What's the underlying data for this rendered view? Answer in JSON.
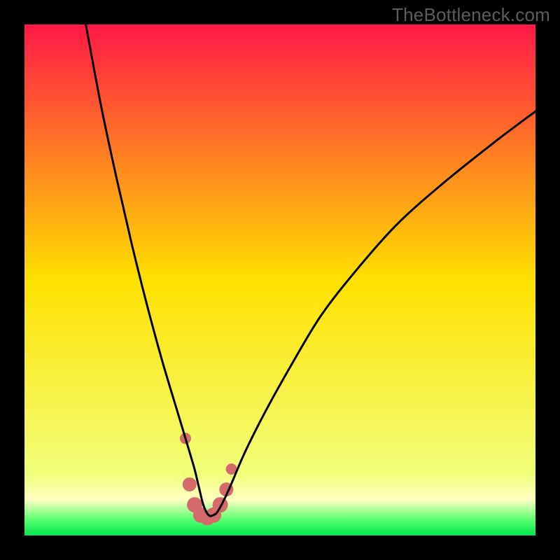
{
  "watermark": "TheBottleneck.com",
  "chart_data": {
    "type": "line",
    "title": "",
    "xlabel": "",
    "ylabel": "",
    "xlim": [
      0,
      100
    ],
    "ylim": [
      0,
      100
    ],
    "grid": false,
    "legend": false,
    "gradient": {
      "orientation": "vertical",
      "stops": [
        {
          "offset": 0.0,
          "color": "#ff1846"
        },
        {
          "offset": 0.5,
          "color": "#ffe100"
        },
        {
          "offset": 0.88,
          "color": "#f1ff7a"
        },
        {
          "offset": 0.93,
          "color": "#ffffc0"
        },
        {
          "offset": 0.97,
          "color": "#54ff6c"
        },
        {
          "offset": 1.0,
          "color": "#00e651"
        }
      ]
    },
    "series": [
      {
        "name": "bottleneck-curve",
        "color": "#000000",
        "x": [
          12,
          15,
          18,
          21,
          24,
          27,
          30,
          33,
          34,
          35,
          36,
          37,
          38,
          40,
          43,
          47,
          52,
          58,
          65,
          73,
          82,
          92,
          100
        ],
        "y": [
          100,
          84,
          70,
          57,
          45,
          34,
          24,
          14,
          10,
          6,
          4,
          4,
          5,
          9,
          16,
          24,
          33,
          43,
          52,
          61,
          69,
          77,
          83
        ]
      }
    ],
    "markers": {
      "name": "fit-zone",
      "color": "#d46a6a",
      "points": [
        {
          "x": 31.5,
          "y": 19,
          "r": 8
        },
        {
          "x": 32.3,
          "y": 10,
          "r": 10
        },
        {
          "x": 33.3,
          "y": 6,
          "r": 11
        },
        {
          "x": 34.5,
          "y": 4,
          "r": 11
        },
        {
          "x": 35.8,
          "y": 3.5,
          "r": 11
        },
        {
          "x": 37.0,
          "y": 4,
          "r": 11
        },
        {
          "x": 38.3,
          "y": 6,
          "r": 11
        },
        {
          "x": 39.5,
          "y": 9,
          "r": 10
        },
        {
          "x": 40.5,
          "y": 13,
          "r": 8
        }
      ]
    }
  }
}
